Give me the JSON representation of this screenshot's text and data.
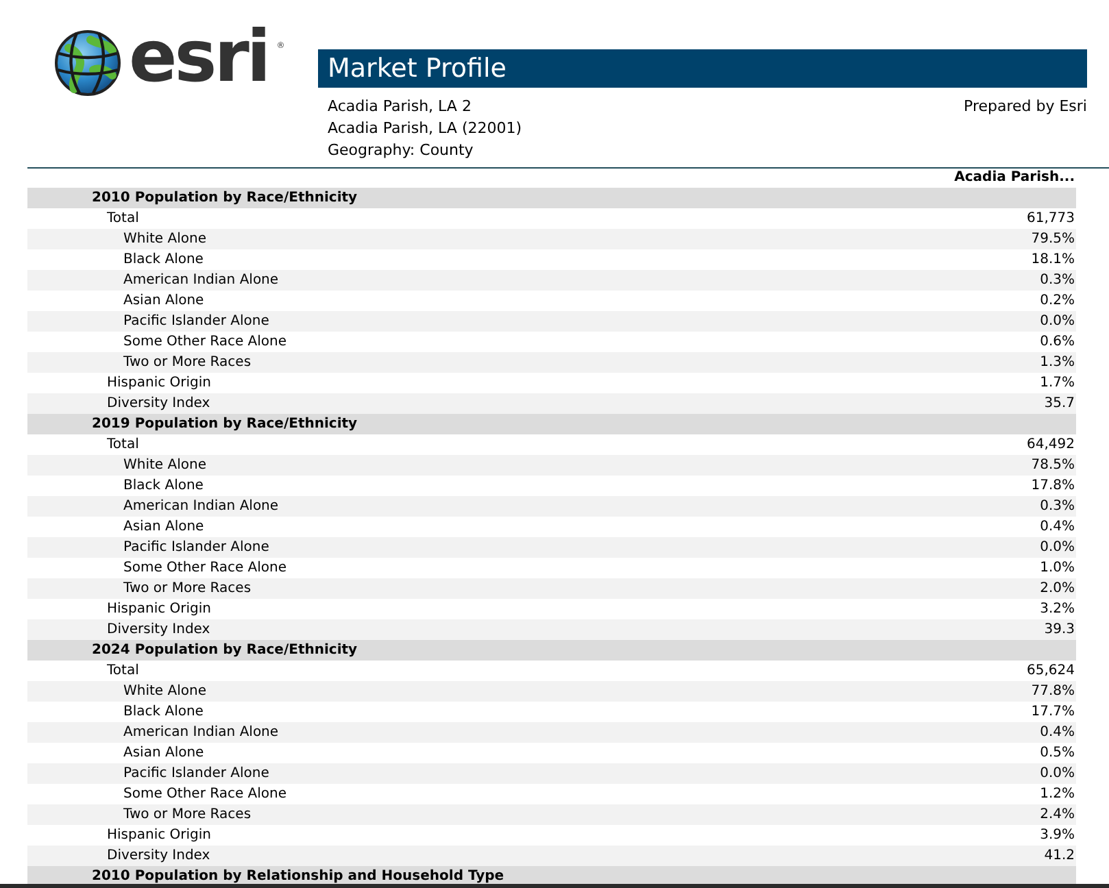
{
  "logo": {
    "text": "esri",
    "mark": "®"
  },
  "report": {
    "title": "Market Profile",
    "address_lines": [
      "Acadia Parish, LA 2",
      "Acadia Parish, LA (22001)",
      "Geography: County"
    ],
    "prepared_by": "Prepared by Esri"
  },
  "table": {
    "columns": [
      "Acadia Parish..."
    ],
    "sections": [
      {
        "title": "2010 Population by Race/Ethnicity",
        "rows": [
          {
            "label": "Total",
            "value": "61,773",
            "children": [
              {
                "label": "White Alone",
                "value": "79.5%"
              },
              {
                "label": "Black Alone",
                "value": "18.1%"
              },
              {
                "label": "American Indian Alone",
                "value": "0.3%"
              },
              {
                "label": "Asian Alone",
                "value": "0.2%"
              },
              {
                "label": "Pacific Islander Alone",
                "value": "0.0%"
              },
              {
                "label": "Some Other Race Alone",
                "value": "0.6%"
              },
              {
                "label": "Two or More Races",
                "value": "1.3%"
              }
            ]
          },
          {
            "label": "Hispanic Origin",
            "value": "1.7%"
          },
          {
            "label": "Diversity Index",
            "value": "35.7"
          }
        ]
      },
      {
        "title": "2019 Population by Race/Ethnicity",
        "rows": [
          {
            "label": "Total",
            "value": "64,492",
            "children": [
              {
                "label": "White Alone",
                "value": "78.5%"
              },
              {
                "label": "Black Alone",
                "value": "17.8%"
              },
              {
                "label": "American Indian Alone",
                "value": "0.3%"
              },
              {
                "label": "Asian Alone",
                "value": "0.4%"
              },
              {
                "label": "Pacific Islander Alone",
                "value": "0.0%"
              },
              {
                "label": "Some Other Race Alone",
                "value": "1.0%"
              },
              {
                "label": "Two or More Races",
                "value": "2.0%"
              }
            ]
          },
          {
            "label": "Hispanic Origin",
            "value": "3.2%"
          },
          {
            "label": "Diversity Index",
            "value": "39.3"
          }
        ]
      },
      {
        "title": "2024 Population by Race/Ethnicity",
        "rows": [
          {
            "label": "Total",
            "value": "65,624",
            "children": [
              {
                "label": "White Alone",
                "value": "77.8%"
              },
              {
                "label": "Black Alone",
                "value": "17.7%"
              },
              {
                "label": "American Indian Alone",
                "value": "0.4%"
              },
              {
                "label": "Asian Alone",
                "value": "0.5%"
              },
              {
                "label": "Pacific Islander Alone",
                "value": "0.0%"
              },
              {
                "label": "Some Other Race Alone",
                "value": "1.2%"
              },
              {
                "label": "Two or More Races",
                "value": "2.4%"
              }
            ]
          },
          {
            "label": "Hispanic Origin",
            "value": "3.9%"
          },
          {
            "label": "Diversity Index",
            "value": "41.2"
          }
        ]
      },
      {
        "title": "2010 Population by Relationship and Household Type"
      }
    ]
  }
}
